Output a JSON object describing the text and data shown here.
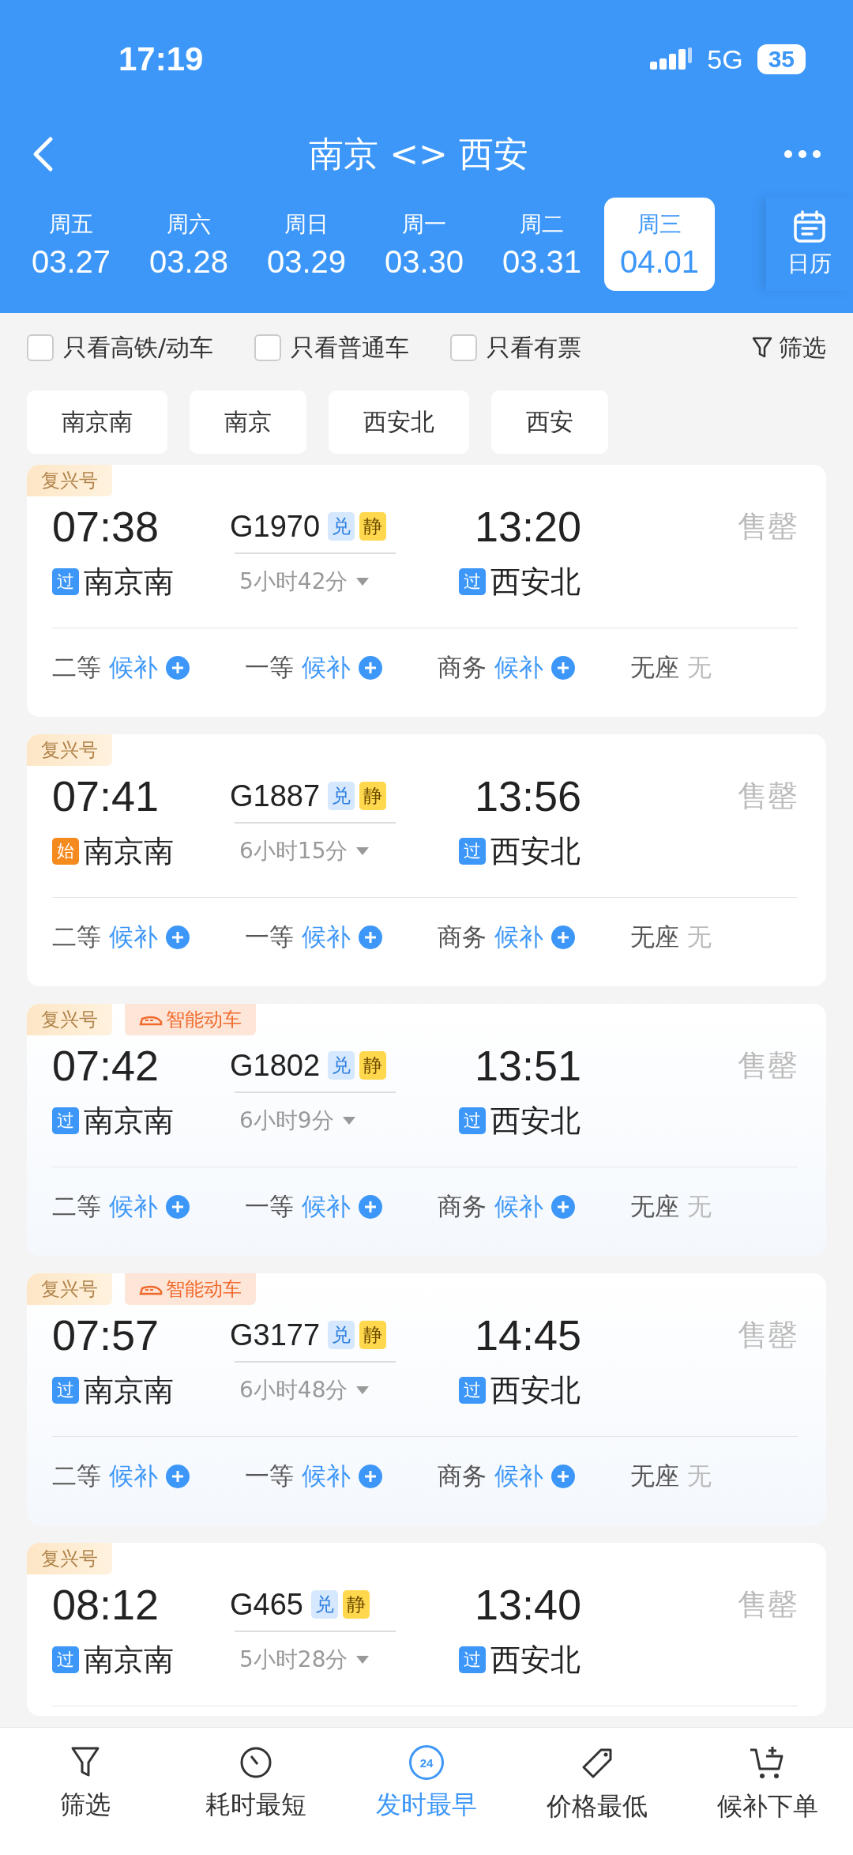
{
  "status_bar": {
    "time": "17:19",
    "network": "5G",
    "battery": "35"
  },
  "header": {
    "title": "南京 <> 西安"
  },
  "dates": [
    {
      "weekday": "周五",
      "date": "03.27",
      "selected": false
    },
    {
      "weekday": "周六",
      "date": "03.28",
      "selected": false
    },
    {
      "weekday": "周日",
      "date": "03.29",
      "selected": false
    },
    {
      "weekday": "周一",
      "date": "03.30",
      "selected": false
    },
    {
      "weekday": "周二",
      "date": "03.31",
      "selected": false
    },
    {
      "weekday": "周三",
      "date": "04.01",
      "selected": true
    }
  ],
  "calendar_button": {
    "label": "日历"
  },
  "filters": [
    {
      "label": "只看高铁/动车",
      "checked": false
    },
    {
      "label": "只看普通车",
      "checked": false
    },
    {
      "label": "只看有票",
      "checked": false
    }
  ],
  "filter_link": {
    "label": "筛选"
  },
  "stations": [
    "南京南",
    "南京",
    "西安北",
    "西安"
  ],
  "trains": [
    {
      "tags": [
        {
          "kind": "fuxing",
          "label": "复兴号"
        }
      ],
      "depart": "07:38",
      "train_no": "G1970",
      "badges": [
        {
          "kind": "exchange",
          "label": "兑"
        },
        {
          "kind": "quiet",
          "label": "静"
        }
      ],
      "arrive": "13:20",
      "from_mark": {
        "kind": "pass",
        "label": "过"
      },
      "from": "南京南",
      "duration": "5小时42分",
      "to_mark": {
        "kind": "pass",
        "label": "过"
      },
      "to": "西安北",
      "status": "售罄",
      "seats": [
        {
          "class": "二等",
          "kind": "waitlist",
          "value": "候补"
        },
        {
          "class": "一等",
          "kind": "waitlist",
          "value": "候补"
        },
        {
          "class": "商务",
          "kind": "waitlist",
          "value": "候补"
        },
        {
          "class": "无座",
          "kind": "none",
          "value": "无"
        }
      ]
    },
    {
      "tags": [
        {
          "kind": "fuxing",
          "label": "复兴号"
        }
      ],
      "depart": "07:41",
      "train_no": "G1887",
      "badges": [
        {
          "kind": "exchange",
          "label": "兑"
        },
        {
          "kind": "quiet",
          "label": "静"
        }
      ],
      "arrive": "13:56",
      "from_mark": {
        "kind": "start",
        "label": "始"
      },
      "from": "南京南",
      "duration": "6小时15分",
      "to_mark": {
        "kind": "pass",
        "label": "过"
      },
      "to": "西安北",
      "status": "售罄",
      "seats": [
        {
          "class": "二等",
          "kind": "waitlist",
          "value": "候补"
        },
        {
          "class": "一等",
          "kind": "waitlist",
          "value": "候补"
        },
        {
          "class": "商务",
          "kind": "waitlist",
          "value": "候补"
        },
        {
          "class": "无座",
          "kind": "none",
          "value": "无"
        }
      ]
    },
    {
      "tags": [
        {
          "kind": "fuxing",
          "label": "复兴号"
        },
        {
          "kind": "smart",
          "label": "智能动车"
        }
      ],
      "depart": "07:42",
      "train_no": "G1802",
      "badges": [
        {
          "kind": "exchange",
          "label": "兑"
        },
        {
          "kind": "quiet",
          "label": "静"
        }
      ],
      "arrive": "13:51",
      "from_mark": {
        "kind": "pass",
        "label": "过"
      },
      "from": "南京南",
      "duration": "6小时9分",
      "to_mark": {
        "kind": "pass",
        "label": "过"
      },
      "to": "西安北",
      "status": "售罄",
      "seats": [
        {
          "class": "二等",
          "kind": "waitlist",
          "value": "候补"
        },
        {
          "class": "一等",
          "kind": "waitlist",
          "value": "候补"
        },
        {
          "class": "商务",
          "kind": "waitlist",
          "value": "候补"
        },
        {
          "class": "无座",
          "kind": "none",
          "value": "无"
        }
      ]
    },
    {
      "tags": [
        {
          "kind": "fuxing",
          "label": "复兴号"
        },
        {
          "kind": "smart",
          "label": "智能动车"
        }
      ],
      "depart": "07:57",
      "train_no": "G3177",
      "badges": [
        {
          "kind": "exchange",
          "label": "兑"
        },
        {
          "kind": "quiet",
          "label": "静"
        }
      ],
      "arrive": "14:45",
      "from_mark": {
        "kind": "pass",
        "label": "过"
      },
      "from": "南京南",
      "duration": "6小时48分",
      "to_mark": {
        "kind": "pass",
        "label": "过"
      },
      "to": "西安北",
      "status": "售罄",
      "seats": [
        {
          "class": "二等",
          "kind": "waitlist",
          "value": "候补"
        },
        {
          "class": "一等",
          "kind": "waitlist",
          "value": "候补"
        },
        {
          "class": "商务",
          "kind": "waitlist",
          "value": "候补"
        },
        {
          "class": "无座",
          "kind": "none",
          "value": "无"
        }
      ]
    },
    {
      "tags": [
        {
          "kind": "fuxing",
          "label": "复兴号"
        }
      ],
      "depart": "08:12",
      "train_no": "G465",
      "badges": [
        {
          "kind": "exchange",
          "label": "兑"
        },
        {
          "kind": "quiet",
          "label": "静"
        }
      ],
      "arrive": "13:40",
      "from_mark": {
        "kind": "pass",
        "label": "过"
      },
      "from": "南京南",
      "duration": "5小时28分",
      "to_mark": {
        "kind": "pass",
        "label": "过"
      },
      "to": "西安北",
      "status": "售罄"
    }
  ],
  "bottom_nav": [
    {
      "kind": "filter",
      "label": "筛选",
      "selected": false
    },
    {
      "kind": "timer",
      "label": "耗时最短",
      "selected": false
    },
    {
      "kind": "clock24",
      "label": "发时最早",
      "icon_text": "24",
      "selected": true
    },
    {
      "kind": "tag",
      "label": "价格最低",
      "selected": false
    },
    {
      "kind": "cart",
      "label": "候补下单",
      "selected": false
    }
  ]
}
